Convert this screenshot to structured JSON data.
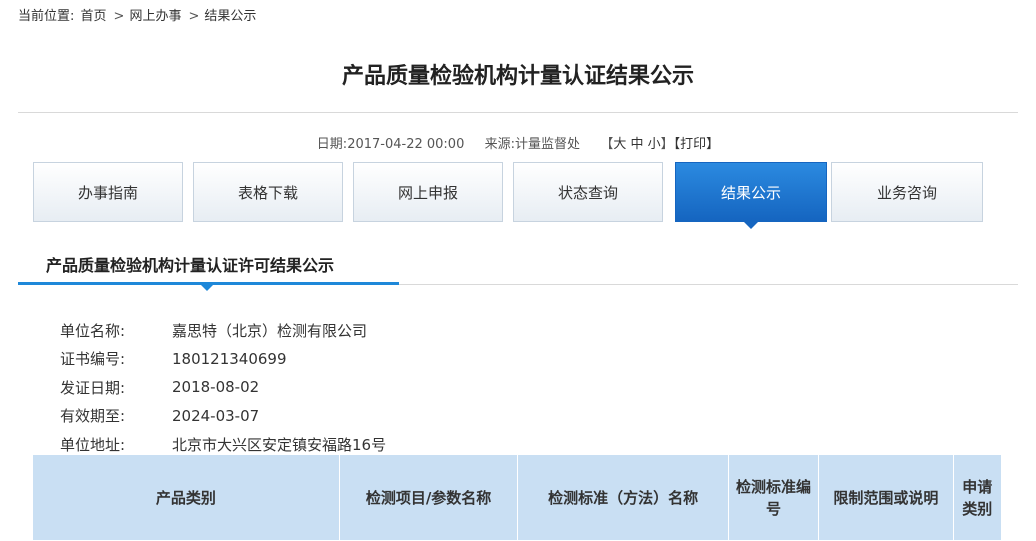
{
  "breadcrumb": {
    "prefix": "当前位置:",
    "items": [
      "首页",
      "网上办事",
      "结果公示"
    ],
    "separator": ">"
  },
  "page_title": "产品质量检验机构计量认证结果公示",
  "meta": {
    "date_label": "日期:",
    "date_value": "2017-04-22 00:00",
    "source_label": "来源:",
    "source_value": "计量监督处",
    "size_open": "【",
    "size_large": "大",
    "size_medium": "中",
    "size_small": "小",
    "size_close": "】",
    "print": "【打印】"
  },
  "tabs": [
    "办事指南",
    "表格下载",
    "网上申报",
    "状态查询",
    "结果公示",
    "业务咨询"
  ],
  "active_tab": "结果公示",
  "section_title": "产品质量检验机构计量认证许可结果公示",
  "info": [
    {
      "label": "单位名称:",
      "value": "嘉思特（北京）检测有限公司"
    },
    {
      "label": "证书编号:",
      "value": "180121340699"
    },
    {
      "label": "发证日期:",
      "value": "2018-08-02"
    },
    {
      "label": "有效期至:",
      "value": "2024-03-07"
    },
    {
      "label": "单位地址:",
      "value": "北京市大兴区安定镇安福路16号"
    }
  ],
  "table": {
    "headers": [
      "产品类别",
      "检测项目/参数名称",
      "检测标准（方法）名称",
      "检测标准编号",
      "限制范围或说明",
      "申请类别"
    ]
  },
  "colors": {
    "accent": "#1e88d9",
    "active_tab": "#1565c0",
    "table_header_bg": "#c9dff3"
  }
}
